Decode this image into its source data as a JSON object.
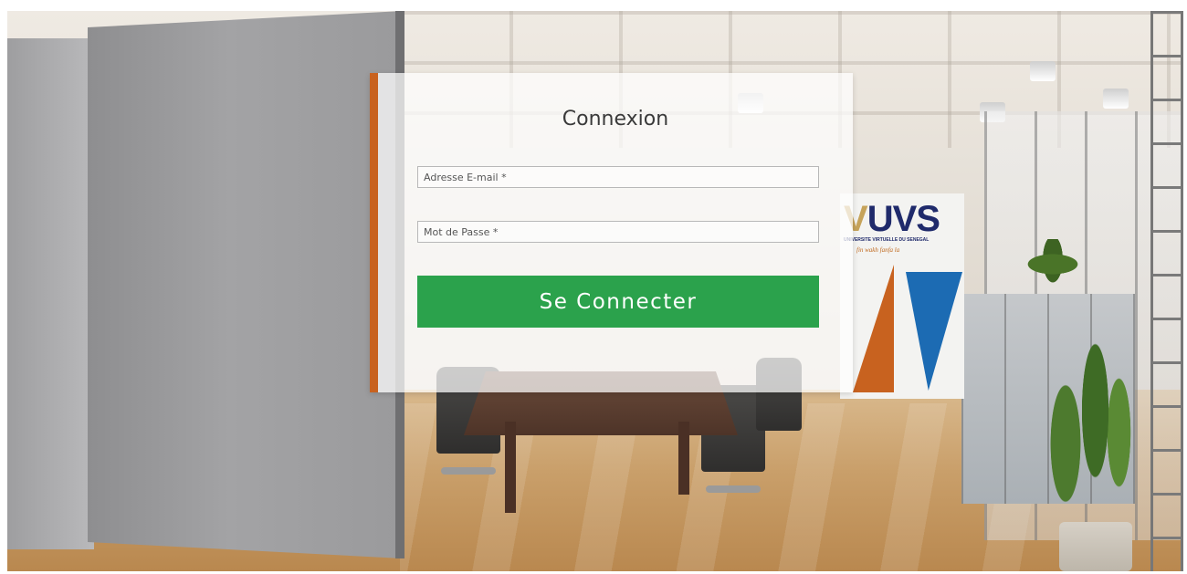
{
  "login": {
    "title": "Connexion",
    "email_placeholder": "Adresse E-mail *",
    "password_placeholder": "Mot de Passe *",
    "submit_label": "Se Connecter"
  },
  "banner": {
    "logo_prefix": "V",
    "logo_text": "UVS",
    "subtitle": "UNIVERSITE VIRTUELLE DU SENEGAL",
    "tagline": "fin wakh fanfa la"
  },
  "colors": {
    "accent": "#c8621f",
    "button": "#2ba24c",
    "logo_blue": "#1c6bb3"
  }
}
